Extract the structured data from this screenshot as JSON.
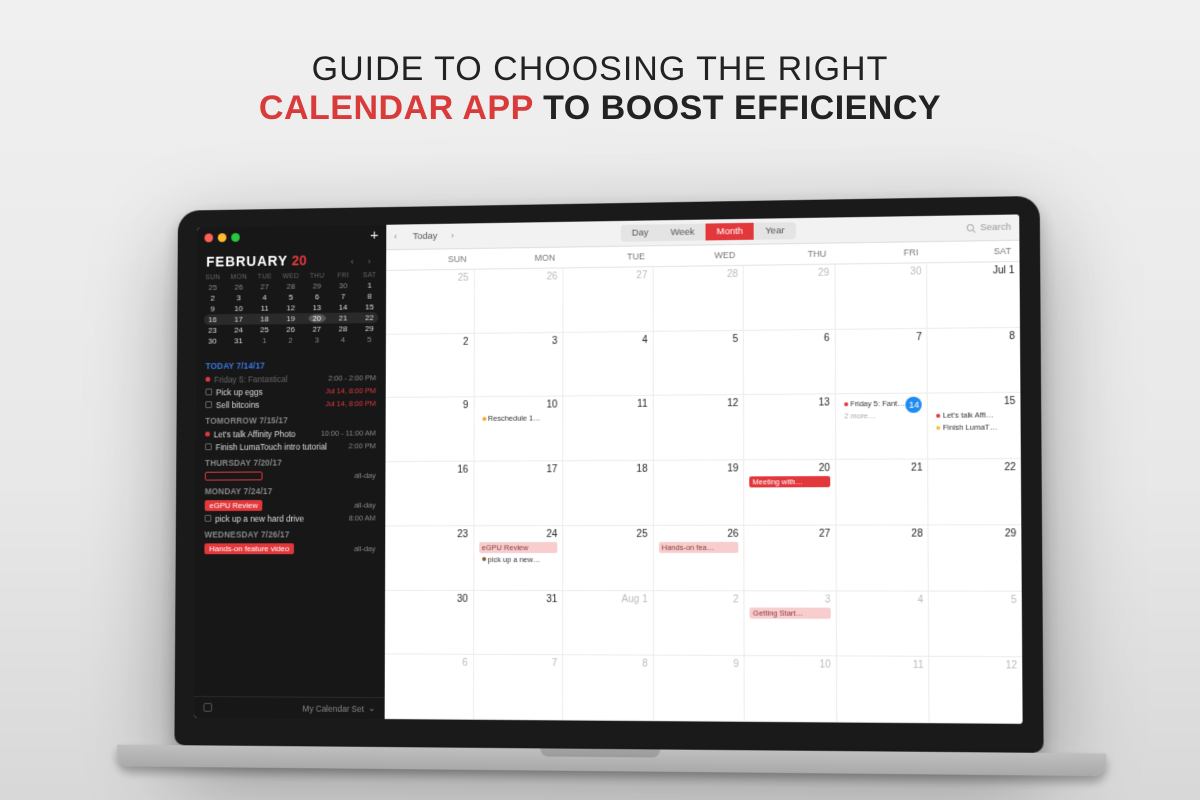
{
  "headline": {
    "line1": "GUIDE TO CHOOSING THE RIGHT",
    "accent": "CALENDAR APP",
    "line2_rest": " TO BOOST EFFICIENCY"
  },
  "sidebar": {
    "month": "FEBRUARY",
    "day": "20",
    "dow": [
      "SUN",
      "MON",
      "TUE",
      "WED",
      "THU",
      "FRI",
      "SAT"
    ],
    "mini": [
      [
        "25",
        "26",
        "27",
        "28",
        "29",
        "30",
        "1"
      ],
      [
        "2",
        "3",
        "4",
        "5",
        "6",
        "7",
        "8"
      ],
      [
        "9",
        "10",
        "11",
        "12",
        "13",
        "14",
        "15"
      ],
      [
        "16",
        "17",
        "18",
        "19",
        "20",
        "21",
        "22"
      ],
      [
        "23",
        "24",
        "25",
        "26",
        "27",
        "28",
        "29"
      ],
      [
        "30",
        "31",
        "1",
        "2",
        "3",
        "4",
        "5"
      ]
    ],
    "agenda": {
      "today_head": "TODAY 7/14/17",
      "today": [
        {
          "type": "dot",
          "txt": "Friday 5: Fantastical",
          "time": "2:00 - 2:00 PM",
          "dim": true
        },
        {
          "type": "cb",
          "txt": "Pick up eggs",
          "time": "Jul 14, 8:00 PM",
          "red": true
        },
        {
          "type": "cb",
          "txt": "Sell bitcoins",
          "time": "Jul 14, 8:00 PM",
          "red": true
        }
      ],
      "tomorrow_head": "TOMORROW 7/15/17",
      "tomorrow": [
        {
          "type": "dot",
          "txt": "Let's talk Affinity Photo",
          "time": "10:00 - 11:00 AM"
        },
        {
          "type": "cb",
          "txt": "Finish LumaTouch intro tutorial",
          "time": "2:00 PM"
        }
      ],
      "thu_head": "THURSDAY 7/20/17",
      "thu_time": "all-day",
      "mon_head": "MONDAY 7/24/17",
      "mon": [
        {
          "type": "chip",
          "txt": "eGPU Review",
          "time": "all-day"
        },
        {
          "type": "cb",
          "txt": "pick up a new hard drive",
          "time": "8:00 AM"
        }
      ],
      "wed_head": "WEDNESDAY 7/26/17",
      "wed": [
        {
          "type": "chip",
          "txt": "Hands-on feature video",
          "time": "all-day"
        }
      ]
    },
    "footer": "My Calendar Set"
  },
  "toolbar": {
    "today": "Today",
    "views": {
      "day": "Day",
      "week": "Week",
      "month": "Month",
      "year": "Year"
    },
    "search": "Search"
  },
  "main_dow": [
    "SUN",
    "MON",
    "TUE",
    "WED",
    "THU",
    "FRI",
    "SAT"
  ],
  "weeks": [
    {
      "cells": [
        {
          "n": "25",
          "dim": true
        },
        {
          "n": "26",
          "dim": true
        },
        {
          "n": "27",
          "dim": true
        },
        {
          "n": "28",
          "dim": true
        },
        {
          "n": "29",
          "dim": true
        },
        {
          "n": "30",
          "dim": true
        },
        {
          "n": "Jul 1"
        }
      ]
    },
    {
      "cells": [
        {
          "n": "2"
        },
        {
          "n": "3"
        },
        {
          "n": "4"
        },
        {
          "n": "5"
        },
        {
          "n": "6"
        },
        {
          "n": "7"
        },
        {
          "n": "8"
        }
      ]
    },
    {
      "cells": [
        {
          "n": "9"
        },
        {
          "n": "10",
          "ev": [
            {
              "c": "oc",
              "t": "Reschedule 1…"
            }
          ]
        },
        {
          "n": "11"
        },
        {
          "n": "12"
        },
        {
          "n": "13"
        },
        {
          "n": "14",
          "today": true,
          "ev": [
            {
              "c": "rc",
              "t": "Friday 5: Fant…"
            },
            {
              "more": "2 more…"
            }
          ]
        },
        {
          "n": "15",
          "ev": [
            {
              "c": "rc",
              "t": "Let's talk Affi…"
            },
            {
              "c": "yc",
              "t": "Finish LumaT…"
            }
          ]
        }
      ]
    },
    {
      "cells": [
        {
          "n": "16"
        },
        {
          "n": "17"
        },
        {
          "n": "18"
        },
        {
          "n": "19"
        },
        {
          "n": "20",
          "ev": [
            {
              "bg": "red",
              "t": "Meeting with…"
            }
          ]
        },
        {
          "n": "21"
        },
        {
          "n": "22"
        }
      ]
    },
    {
      "cells": [
        {
          "n": "23"
        },
        {
          "n": "24",
          "ev": [
            {
              "bg": "pink",
              "t": "eGPU Review"
            },
            {
              "c": "bc",
              "t": "pick up a new…"
            }
          ]
        },
        {
          "n": "25"
        },
        {
          "n": "26",
          "ev": [
            {
              "bg": "pink",
              "t": "Hands-on fea…"
            }
          ]
        },
        {
          "n": "27"
        },
        {
          "n": "28"
        },
        {
          "n": "29"
        }
      ]
    },
    {
      "cells": [
        {
          "n": "30"
        },
        {
          "n": "31"
        },
        {
          "n": "Aug 1",
          "dim": true
        },
        {
          "n": "2",
          "dim": true
        },
        {
          "n": "3",
          "dim": true,
          "ev": [
            {
              "bg": "pink",
              "t": "Getting Start…"
            }
          ]
        },
        {
          "n": "4",
          "dim": true
        },
        {
          "n": "5",
          "dim": true
        }
      ]
    },
    {
      "cells": [
        {
          "n": "6",
          "dim": true
        },
        {
          "n": "7",
          "dim": true
        },
        {
          "n": "8",
          "dim": true
        },
        {
          "n": "9",
          "dim": true
        },
        {
          "n": "10",
          "dim": true
        },
        {
          "n": "11",
          "dim": true
        },
        {
          "n": "12",
          "dim": true
        }
      ]
    }
  ]
}
